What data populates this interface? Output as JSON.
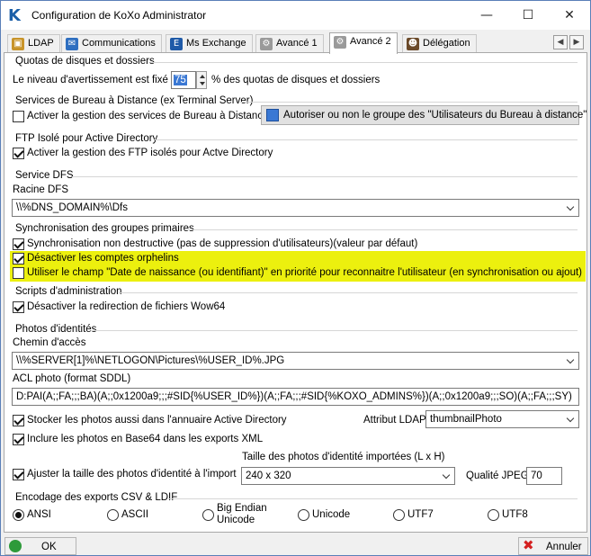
{
  "window": {
    "title": "Configuration de KoXo Administrator",
    "logo_letter": "K",
    "controls": [
      "minimize-icon",
      "maximize-icon",
      "close-icon"
    ]
  },
  "tabs": [
    {
      "label": "LDAP",
      "icon": "ldap-icon"
    },
    {
      "label": "Communications",
      "icon": "communications-icon"
    },
    {
      "label": "Ms Exchange",
      "icon": "exchange-icon"
    },
    {
      "label": "Avancé 1",
      "icon": "gear-icon"
    },
    {
      "label": "Avancé 2",
      "icon": "gear-icon",
      "active": true
    },
    {
      "label": "Délégation",
      "icon": "user-icon"
    }
  ],
  "quota": {
    "title": "Quotas de disques et dossiers",
    "label_before": "Le niveau d'avertissement est fixé à",
    "value": "75",
    "label_after": "% des quotas de disques et dossiers"
  },
  "rds": {
    "title": "Services de Bureau à Distance (ex Terminal Server)",
    "checkbox_label": "Activer la gestion des services de Bureau à Distance",
    "checked": false,
    "button_label": "Autoriser ou non le groupe des \"Utilisateurs du Bureau à distance\""
  },
  "ftp": {
    "title": "FTP Isolé pour Active Directory",
    "checkbox_label": "Activer la gestion des FTP isolés pour Actve Directory",
    "checked": true
  },
  "dfs": {
    "title": "Service DFS",
    "root_label": "Racine DFS",
    "root_value": "\\\\%DNS_DOMAIN%\\Dfs"
  },
  "sync": {
    "title": "Synchronisation des groupes primaires",
    "items": [
      {
        "label": "Synchronisation non destructive (pas de suppression d'utilisateurs)(valeur par défaut)",
        "checked": true
      },
      {
        "label": "Désactiver les comptes orphelins",
        "checked": true
      },
      {
        "label": "Utiliser le champ \"Date de naissance (ou identifiant)\" en priorité pour reconnaitre l'utilisateur (en synchronisation ou ajout)",
        "checked": false
      }
    ]
  },
  "scripts": {
    "title": "Scripts d'administration",
    "checkbox_label": "Désactiver la redirection de fichiers Wow64",
    "checked": true
  },
  "photos": {
    "title": "Photos d'identités",
    "path_label": "Chemin d'accès",
    "path_value": "\\\\%SERVER[1]%\\NETLOGON\\Pictures\\%USER_ID%.JPG",
    "acl_label": "ACL photo (format SDDL)",
    "acl_value": "D:PAI(A;;FA;;;BA)(A;;0x1200a9;;;#SID{%USER_ID%})(A;;FA;;;#SID{%KOXO_ADMINS%})(A;;0x1200a9;;;SO)(A;;FA;;;SY)",
    "store_ad_label": "Stocker les photos aussi dans l'annuaire Active Directory",
    "store_ad_checked": true,
    "ldap_attr_label": "Attribut LDAP",
    "ldap_attr_value": "thumbnailPhoto",
    "base64_label": "Inclure les photos en Base64 dans les exports XML",
    "base64_checked": true,
    "size_title": "Taille des photos d'identité importées (L x H)",
    "resize_label": "Ajuster la taille des photos d'identité à l'import",
    "resize_checked": true,
    "size_value": "240 x 320",
    "jpeg_label": "Qualité JPEG",
    "jpeg_value": "70"
  },
  "encoding": {
    "title": "Encodage des exports CSV & LDIF",
    "options": [
      {
        "label": "ANSI",
        "checked": true
      },
      {
        "label": "ASCII",
        "checked": false
      },
      {
        "label": "Big Endian\nUnicode",
        "checked": false
      },
      {
        "label": "Unicode",
        "checked": false
      },
      {
        "label": "UTF7",
        "checked": false
      },
      {
        "label": "UTF8",
        "checked": false
      }
    ]
  },
  "footer": {
    "ok_label": "OK",
    "cancel_label": "Annuler"
  },
  "colors": {
    "highlight": "#ecf00e",
    "accent": "#1b5fa8"
  }
}
